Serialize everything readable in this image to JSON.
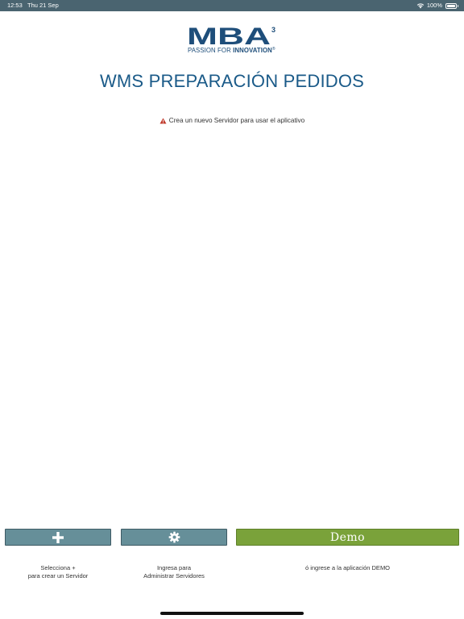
{
  "status_bar": {
    "time": "12:53",
    "date": "Thu 21 Sep",
    "battery": "100%",
    "icons": [
      "wifi-icon",
      "battery-icon"
    ]
  },
  "brand": {
    "logo_text": "MBA",
    "logo_superscript": "3",
    "tagline_prefix": "PASSION FOR",
    "tagline_emphasis": "INNOVATION",
    "registered_mark": "®",
    "color": "#1e4e7a"
  },
  "page": {
    "title": "WMS PREPARACIÓN PEDIDOS",
    "title_color": "#1a5a88",
    "warning_text": "Crea un nuevo Servidor para usar el aplicativo",
    "warning_icon": "warning-icon"
  },
  "actions": {
    "add": {
      "icon": "plus-icon",
      "caption_line1": "Selecciona +",
      "caption_line2": "para crear un Servidor"
    },
    "settings": {
      "icon": "gear-icon",
      "caption_line1": "Ingresa para",
      "caption_line2": "Administrar Servidores"
    },
    "demo": {
      "label": "Demo",
      "caption": "ó ingrese a la aplicación DEMO"
    }
  },
  "colors": {
    "status_bar": "#4a6470",
    "button_gray": "#668f99",
    "button_green": "#7aa23a",
    "warning_red": "#c0392b"
  }
}
